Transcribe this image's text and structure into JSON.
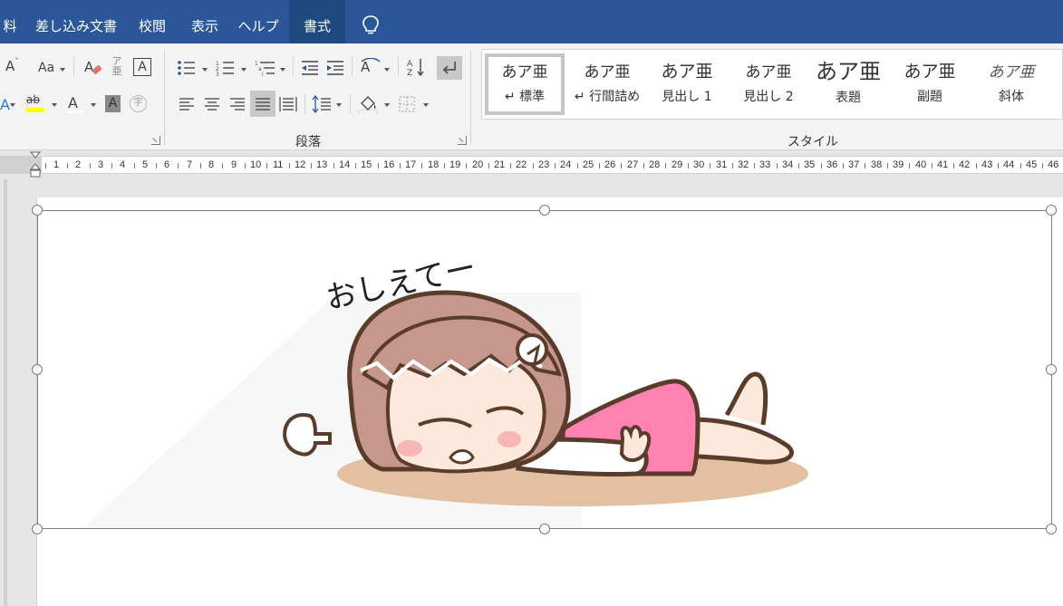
{
  "tabs": [
    {
      "label": "料",
      "active": false
    },
    {
      "label": "差し込み文書",
      "active": false
    },
    {
      "label": "校閲",
      "active": false
    },
    {
      "label": "表示",
      "active": false
    },
    {
      "label": "ヘルプ",
      "active": false
    },
    {
      "label": "書式",
      "active": true
    }
  ],
  "tell_me_icon": "lightbulb-icon",
  "ribbon": {
    "font_group": {
      "shrink_font_label": "A",
      "change_case_label": "Aa",
      "font_color_label": "A",
      "highlight_label": "ab",
      "char_shading_label": "A",
      "enclosed_char_label": "字",
      "char_border_label": "A",
      "phonetic_label": "亜",
      "highlight_color": "#ffff00",
      "font_color": "#c00000"
    },
    "paragraph_group": {
      "label": "段落"
    },
    "styles_group": {
      "label": "スタイル",
      "items": [
        {
          "sample": "あア亜",
          "name": "↵ 標準",
          "selected": true
        },
        {
          "sample": "あア亜",
          "name": "↵ 行間詰め",
          "selected": false
        },
        {
          "sample": "あア亜",
          "name": "見出し 1",
          "selected": false
        },
        {
          "sample": "あア亜",
          "name": "見出し 2",
          "selected": false
        },
        {
          "sample": "あア亜",
          "name": "表題",
          "selected": false
        },
        {
          "sample": "あア亜",
          "name": "副題",
          "selected": false
        },
        {
          "sample": "あア亜",
          "name": "斜体",
          "selected": false
        }
      ]
    }
  },
  "ruler": {
    "numbers": [
      1,
      2,
      3,
      4,
      5,
      6,
      7,
      8,
      9,
      10,
      11,
      12,
      13,
      14,
      15,
      16,
      17,
      18,
      19,
      20,
      21,
      22,
      23,
      24,
      25,
      26,
      27,
      28,
      29,
      30,
      31,
      32,
      33,
      34,
      35,
      36,
      37,
      38,
      39,
      40,
      41,
      42,
      43,
      44,
      45,
      46
    ]
  },
  "document": {
    "image": {
      "caption_text": "おしえてー",
      "description_icon": "tired-girl-lying-illustration",
      "colors": {
        "hair": "#c8978c",
        "outline": "#5a3c2a",
        "dress": "#ff82b0",
        "skin": "#fde8dc",
        "shadow": "#e3c0a2",
        "cheek": "#f7b6b6"
      }
    }
  }
}
